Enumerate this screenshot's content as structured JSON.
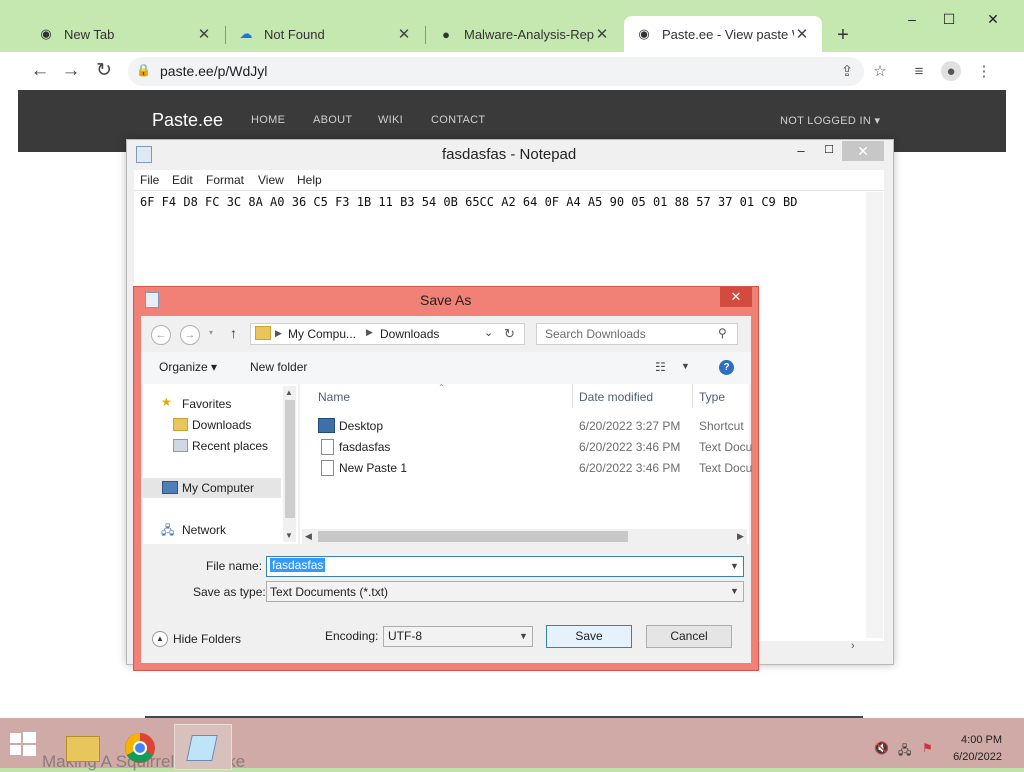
{
  "browser": {
    "tabs": [
      {
        "label": "New Tab",
        "icon": "chrome-icon"
      },
      {
        "label": "Not Found",
        "icon": "cloud-icon"
      },
      {
        "label": "Malware-Analysis-Report",
        "icon": "github-icon"
      },
      {
        "label": "Paste.ee - View paste Wd",
        "icon": "chrome-icon"
      }
    ],
    "url": "paste.ee/p/WdJyl"
  },
  "site": {
    "brand": "Paste.ee",
    "nav": [
      "HOME",
      "ABOUT",
      "WIKI",
      "CONTACT"
    ],
    "account": "NOT LOGGED IN"
  },
  "notepad": {
    "title": "fasdasfas - Notepad",
    "menu": [
      "File",
      "Edit",
      "Format",
      "View",
      "Help"
    ],
    "content": "6F F4 D8 FC 3C 8A A0 36 C5 F3 1B 11 B3 54 0B 65CC A2 64 0F A4 A5 90 05 01 88 57 37 01 C9 BD"
  },
  "saveas": {
    "title": "Save As",
    "breadcrumb": [
      "My Compu...",
      "Downloads"
    ],
    "search_placeholder": "Search Downloads",
    "organize": "Organize",
    "new_folder": "New folder",
    "nav": {
      "favorites": "Favorites",
      "downloads": "Downloads",
      "recent": "Recent places",
      "mycomputer": "My Computer",
      "network": "Network"
    },
    "columns": [
      "Name",
      "Date modified",
      "Type"
    ],
    "files": [
      {
        "name": "Desktop",
        "date": "6/20/2022 3:27 PM",
        "type": "Shortcut"
      },
      {
        "name": "fasdasfas",
        "date": "6/20/2022 3:46 PM",
        "type": "Text Docu"
      },
      {
        "name": "New Paste 1",
        "date": "6/20/2022 3:46 PM",
        "type": "Text Docu"
      }
    ],
    "file_name_label": "File name:",
    "file_name": "fasdasfas",
    "save_type_label": "Save as type:",
    "save_type": "Text Documents (*.txt)",
    "hide_folders": "Hide Folders",
    "encoding_label": "Encoding:",
    "encoding": "UTF-8",
    "save": "Save",
    "cancel": "Cancel"
  },
  "taskbar": {
    "time": "4:00 PM",
    "date": "6/20/2022"
  },
  "background_text": "Making A Squirrel Pancake"
}
